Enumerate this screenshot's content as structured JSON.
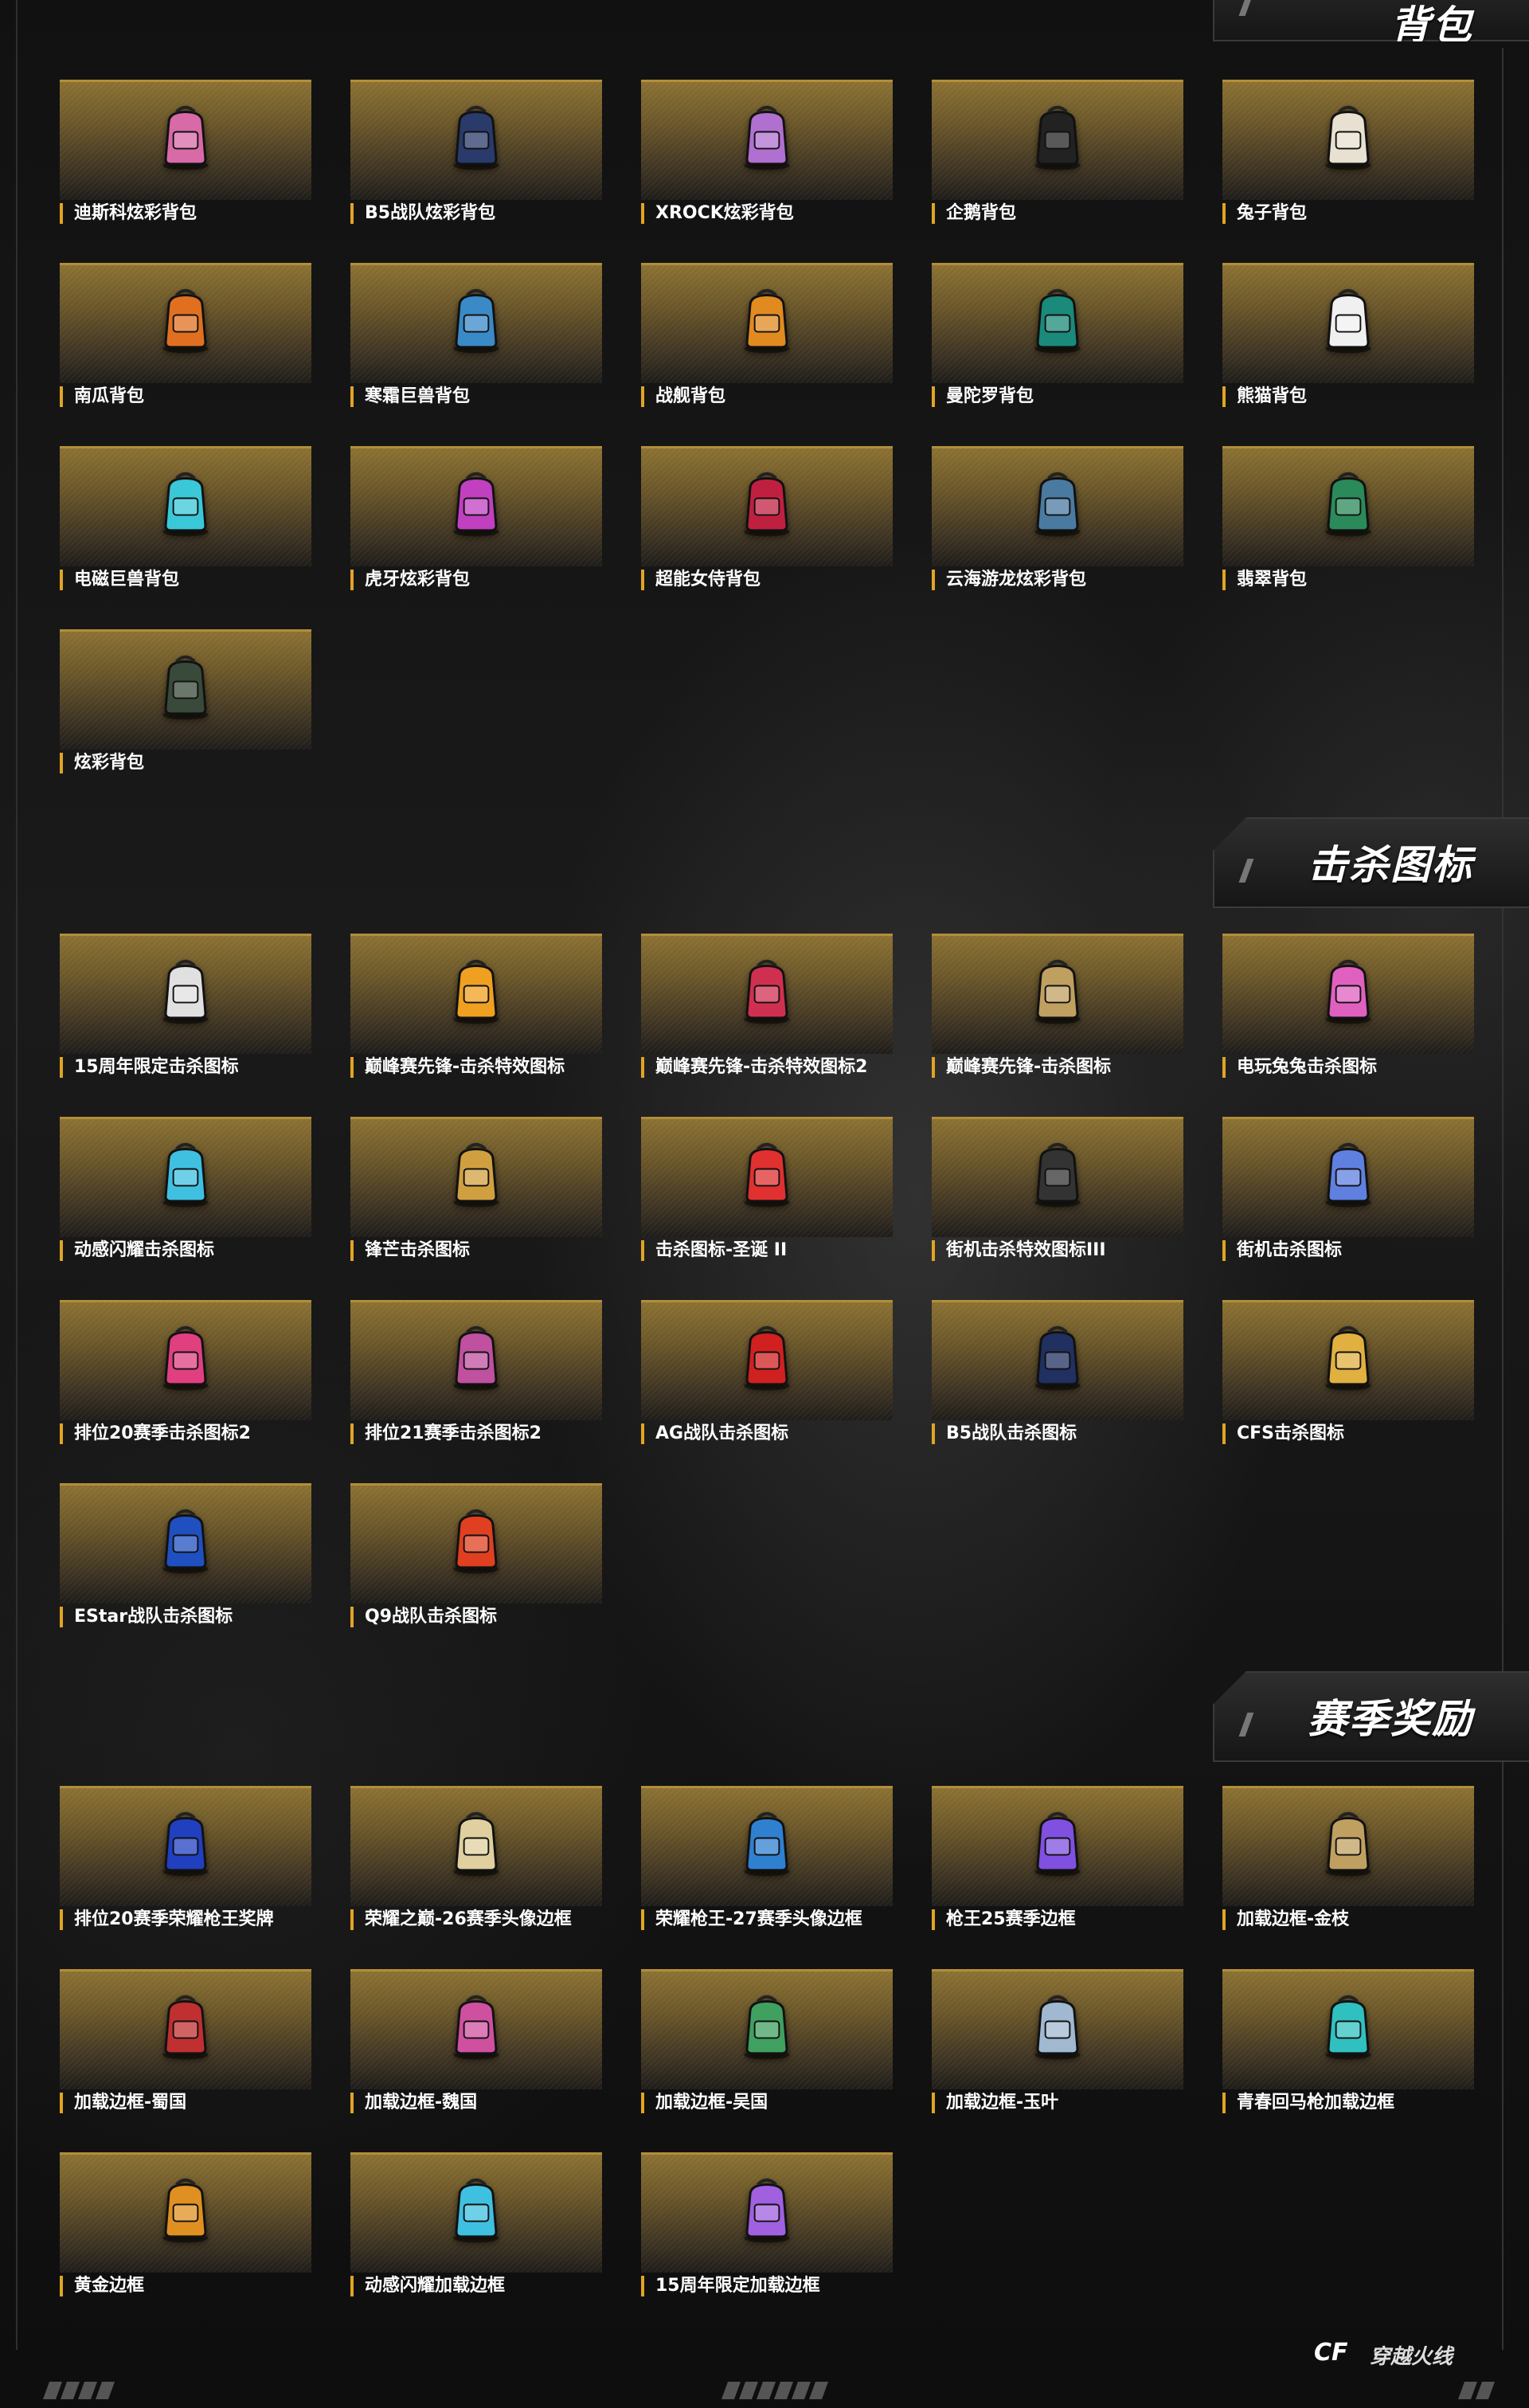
{
  "sections": [
    {
      "title": "背包",
      "items": [
        {
          "label": "迪斯科炫彩背包",
          "icon": "backpack-pink-icon",
          "color": "#d86aa8"
        },
        {
          "label": "B5战队炫彩背包",
          "icon": "backpack-navy-icon",
          "color": "#2a3a6a"
        },
        {
          "label": "XROCK炫彩背包",
          "icon": "backpack-purple-icon",
          "color": "#b070d0"
        },
        {
          "label": "企鹅背包",
          "icon": "penguin-backpack-icon",
          "color": "#222222"
        },
        {
          "label": "兔子背包",
          "icon": "rabbit-backpack-icon",
          "color": "#e8e0d0"
        },
        {
          "label": "南瓜背包",
          "icon": "pumpkin-backpack-icon",
          "color": "#e07020"
        },
        {
          "label": "寒霜巨兽背包",
          "icon": "frost-beast-backpack-icon",
          "color": "#3a8ac8"
        },
        {
          "label": "战舰背包",
          "icon": "battleship-backpack-icon",
          "color": "#e08a20"
        },
        {
          "label": "曼陀罗背包",
          "icon": "mandala-backpack-icon",
          "color": "#1a8a7a"
        },
        {
          "label": "熊猫背包",
          "icon": "panda-backpack-icon",
          "color": "#f0f0f0"
        },
        {
          "label": "电磁巨兽背包",
          "icon": "electro-beast-backpack-icon",
          "color": "#3ac8d8"
        },
        {
          "label": "虎牙炫彩背包",
          "icon": "huya-backpack-icon",
          "color": "#c040c0"
        },
        {
          "label": "超能女侍背包",
          "icon": "super-maid-backpack-icon",
          "color": "#c02040"
        },
        {
          "label": "云海游龙炫彩背包",
          "icon": "cloud-dragon-backpack-icon",
          "color": "#4a7aa0"
        },
        {
          "label": "翡翠背包",
          "icon": "jade-backpack-icon",
          "color": "#2a8a5a"
        },
        {
          "label": "炫彩背包",
          "icon": "backpack-dark-green-icon",
          "color": "#3a4a3a"
        }
      ]
    },
    {
      "title": "击杀图标",
      "items": [
        {
          "label": "15周年限定击杀图标",
          "icon": "skull-compass-icon",
          "color": "#e0e0e0"
        },
        {
          "label": "巅峰赛先锋-击杀特效图标",
          "icon": "trophy-icon",
          "color": "#f0a020"
        },
        {
          "label": "巅峰赛先锋-击杀特效图标2",
          "icon": "crown-skull-icon",
          "color": "#d03050"
        },
        {
          "label": "巅峰赛先锋-击杀图标",
          "icon": "armored-skull-icon",
          "color": "#c0a060"
        },
        {
          "label": "电玩兔兔击杀图标",
          "icon": "winged-skull-pink-icon",
          "color": "#e060c0"
        },
        {
          "label": "动感闪耀击杀图标",
          "icon": "star-skull-icon",
          "color": "#40c0e0"
        },
        {
          "label": "锋芒击杀图标",
          "icon": "golden-wing-skull-icon",
          "color": "#d0a040"
        },
        {
          "label": "击杀图标-圣诞 II",
          "icon": "santa-icon",
          "color": "#e03030"
        },
        {
          "label": "街机击杀特效图标III",
          "icon": "bomb-icon",
          "color": "#333333"
        },
        {
          "label": "街机击杀图标",
          "icon": "headshot-skull-icon",
          "color": "#6080e0"
        },
        {
          "label": "排位20赛季击杀图标2",
          "icon": "ranked-skull-icon",
          "color": "#e04080"
        },
        {
          "label": "排位21赛季击杀图标2",
          "icon": "ranked-skull-icon",
          "color": "#c050a0"
        },
        {
          "label": "AG战队击杀图标",
          "icon": "team-skull-red-icon",
          "color": "#d02020"
        },
        {
          "label": "B5战队击杀图标",
          "icon": "team-skull-navy-icon",
          "color": "#203060"
        },
        {
          "label": "CFS击杀图标",
          "icon": "winged-skull-gold-icon",
          "color": "#e0b040"
        },
        {
          "label": "EStar战队击杀图标",
          "icon": "team-skull-blue-icon",
          "color": "#2050c0"
        },
        {
          "label": "Q9战队击杀图标",
          "icon": "team-skull-orange-icon",
          "color": "#e04020"
        }
      ]
    },
    {
      "title": "赛季奖励",
      "items": [
        {
          "label": "排位20赛季荣耀枪王奖牌",
          "icon": "medal-icon",
          "color": "#2040c0"
        },
        {
          "label": "荣耀之巅-26赛季头像边框",
          "icon": "wing-frame-gold-icon",
          "color": "#e0d0a0"
        },
        {
          "label": "荣耀枪王-27赛季头像边框",
          "icon": "wing-frame-blue-icon",
          "color": "#3080d0"
        },
        {
          "label": "枪王25赛季边框",
          "icon": "frame-purple-icon",
          "color": "#8050e0"
        },
        {
          "label": "加载边框-金枝",
          "icon": "frame-golden-branch-icon",
          "color": "#c0a060"
        },
        {
          "label": "加载边框-蜀国",
          "icon": "frame-shu-icon",
          "color": "#c03030"
        },
        {
          "label": "加载边框-魏国",
          "icon": "frame-wei-icon",
          "color": "#d050a0"
        },
        {
          "label": "加载边框-吴国",
          "icon": "frame-wu-icon",
          "color": "#40a060"
        },
        {
          "label": "加载边框-玉叶",
          "icon": "frame-jade-leaf-icon",
          "color": "#a0b8d0"
        },
        {
          "label": "青春回马枪加载边框",
          "icon": "frame-cyan-icon",
          "color": "#30c0c0"
        },
        {
          "label": "黄金边框",
          "icon": "frame-gold-icon",
          "color": "#e09020"
        },
        {
          "label": "动感闪耀加载边框",
          "icon": "frame-neon-icon",
          "color": "#40c0e0"
        },
        {
          "label": "15周年限定加载边框",
          "icon": "frame-anniversary-icon",
          "color": "#a060e0"
        }
      ]
    }
  ],
  "footer": {
    "logo_mark": "CF",
    "logo_name": "穿越火线"
  }
}
